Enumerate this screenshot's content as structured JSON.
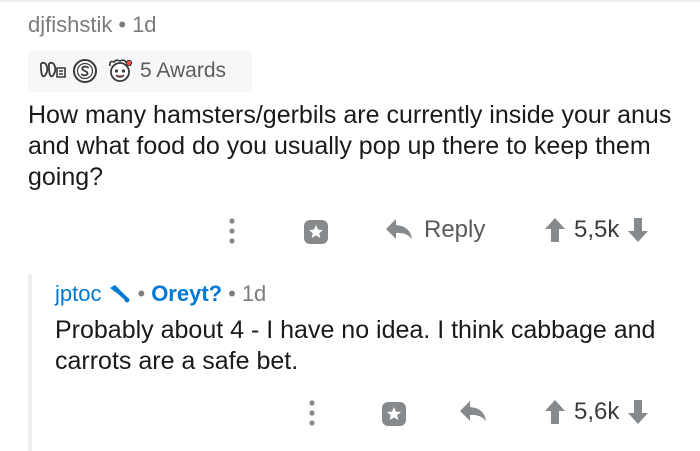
{
  "comment": {
    "username": "djfishstik",
    "age": "1d",
    "awards": {
      "icons": [
        "bravo-award-icon",
        "silver-coin-award-icon",
        "wholesome-award-icon"
      ],
      "count_label": "5 Awards"
    },
    "body": "How many hamsters/gerbils are currently inside your anus and what food do you usually pop up there to keep them going?",
    "actions": {
      "reply_label": "Reply",
      "score": "5,5k"
    }
  },
  "reply": {
    "username": "jptoc",
    "flair": "Oreyt?",
    "age": "1d",
    "body": "Probably about 4 - I have no idea. I think cabbage and carrots are a safe bet.",
    "actions": {
      "score": "5,6k"
    }
  },
  "colors": {
    "username_blue": "#0079d3",
    "meta_grey": "#7c7c7c",
    "icon_grey": "#878a8c",
    "award_bg": "#f6f7f8"
  }
}
